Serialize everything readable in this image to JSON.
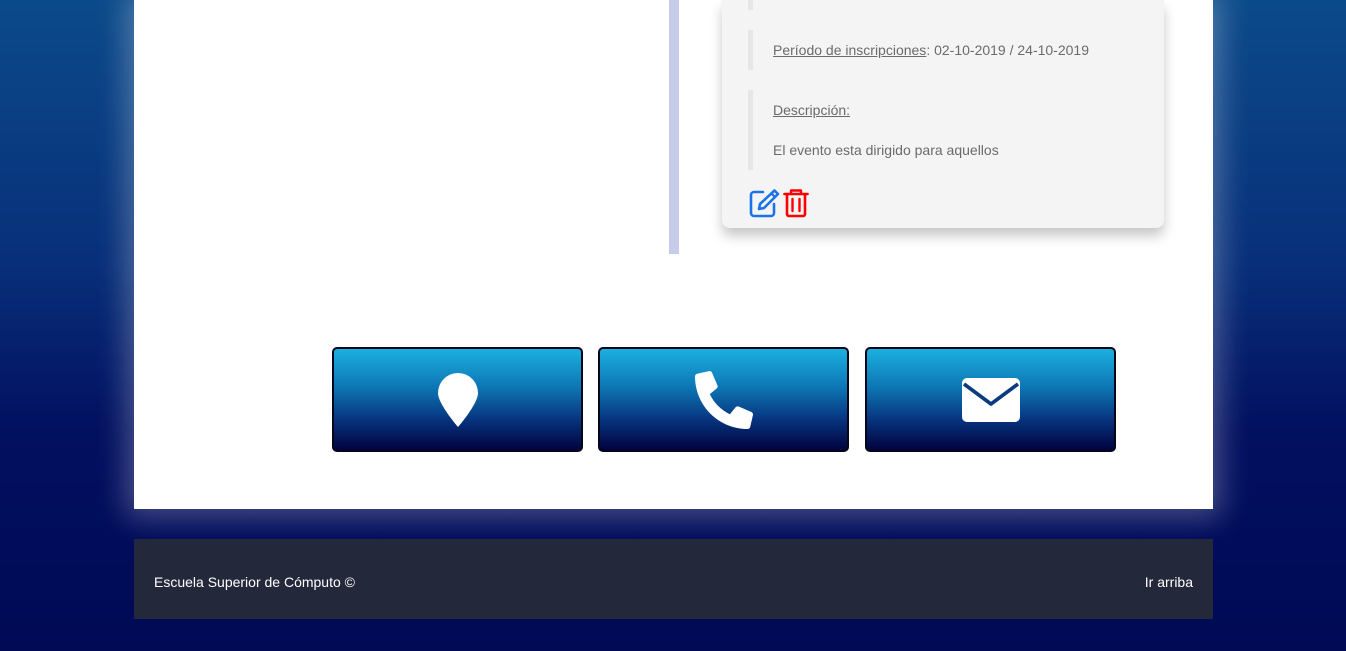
{
  "event": {
    "enrollment_label": "Período de inscripciones",
    "enrollment_sep": ": ",
    "enrollment_value": "02-10-2019 / 24-10-2019",
    "description_label": "Descripción:",
    "description_text": "El evento esta dirigido para aquellos",
    "actions": {
      "edit_icon": "edit-icon",
      "delete_icon": "trash-icon",
      "edit_color": "#1a73e8",
      "delete_color": "#ff0000"
    }
  },
  "contact": {
    "buttons": [
      {
        "icon": "map-marker-icon"
      },
      {
        "icon": "phone-icon"
      },
      {
        "icon": "envelope-icon"
      }
    ]
  },
  "footer": {
    "copyright": "Escuela Superior de Cómputo ©",
    "top_link": "Ir arriba"
  }
}
